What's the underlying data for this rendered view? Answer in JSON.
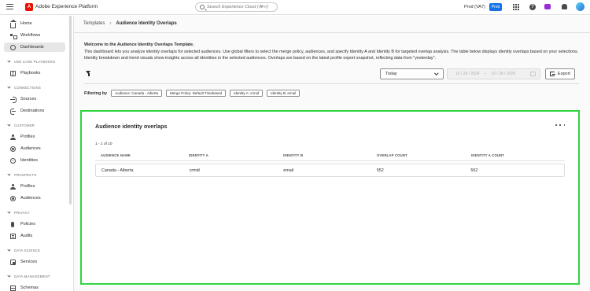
{
  "app": {
    "title": "Adobe Experience Platform",
    "logo_letter": "A"
  },
  "topbar": {
    "search_placeholder": "Search Experience Cloud (⌘+/)",
    "org": "Prod (VA7)",
    "sandbox_badge": "Prod",
    "help_glyph": "?",
    "icons": [
      "apps-grid-icon",
      "help-icon",
      "feedback-icon",
      "notifications-bell-icon",
      "user-avatar"
    ]
  },
  "sidebar": {
    "items": [
      {
        "label": "Home",
        "icon": "home-icon"
      },
      {
        "label": "Workflows",
        "icon": "workflow-icon"
      },
      {
        "label": "Dashboards",
        "icon": "dashboard-icon",
        "active": true
      }
    ],
    "sections": [
      {
        "title": "USE CASE PLAYBOOKS",
        "items": [
          {
            "label": "Playbooks",
            "icon": "book-icon"
          }
        ]
      },
      {
        "title": "CONNECTIONS",
        "items": [
          {
            "label": "Sources",
            "icon": "source-icon"
          },
          {
            "label": "Destinations",
            "icon": "destination-icon"
          }
        ]
      },
      {
        "title": "CUSTOMER",
        "items": [
          {
            "label": "Profiles",
            "icon": "person-icon"
          },
          {
            "label": "Audiences",
            "icon": "audience-icon"
          },
          {
            "label": "Identities",
            "icon": "identity-icon"
          }
        ]
      },
      {
        "title": "PROSPECTS",
        "items": [
          {
            "label": "Profiles",
            "icon": "person-icon"
          },
          {
            "label": "Audiences",
            "icon": "audience-icon"
          }
        ]
      },
      {
        "title": "PRIVACY",
        "items": [
          {
            "label": "Policies",
            "icon": "policy-icon"
          },
          {
            "label": "Audits",
            "icon": "audit-icon"
          }
        ]
      },
      {
        "title": "DATA SCIENCE",
        "items": [
          {
            "label": "Services",
            "icon": "service-icon"
          }
        ]
      },
      {
        "title": "DATA MANAGEMENT",
        "items": [
          {
            "label": "Schemas",
            "icon": "schema-icon"
          }
        ]
      }
    ]
  },
  "breadcrumb": {
    "parent": "Templates",
    "separator": "›",
    "current": "Audience Identity Overlaps"
  },
  "welcome": {
    "title": "Welcome to the Audience Identity Overlaps Template.",
    "body": "This dashboard lets you analyze identity overlaps for selected audiences. Use global filters to select the merge policy, audiences, and specify Identity A and Identity B for targeted overlap analysis. The table below displays identity overlaps based on your selections. Identity breakdown and trend visuals show insights across all identities in the selected audiences. Overlaps are based on the latest profile export snapshot, reflecting data from \"yesterday\"."
  },
  "controls": {
    "date_preset": "Today",
    "date_start": "10 / 28 / 2024",
    "date_range_sep": "–",
    "date_end": "10 / 28 / 2024",
    "export_label": "Export"
  },
  "filters": {
    "label": "Filtering by",
    "chips": [
      "Audience: Canada - Alberta",
      "Merge Policy: Default Timebased",
      "Identity A: crmid",
      "Identity B: email"
    ]
  },
  "card": {
    "title": "Audience identity overlaps",
    "count_text": "1 - 1 of 10",
    "columns": [
      "AUDIENCE NAME",
      "IDENTITY A",
      "IDENTITY B",
      "OVERLAP COUNT",
      "IDENTITY A COUNT"
    ],
    "rows": [
      [
        "Canada - Alberta",
        "crmid",
        "email",
        "552",
        "552"
      ]
    ]
  },
  "colors": {
    "highlight_border": "#2fd443",
    "brand_red": "#eb1000",
    "badge_blue": "#1473e6"
  }
}
